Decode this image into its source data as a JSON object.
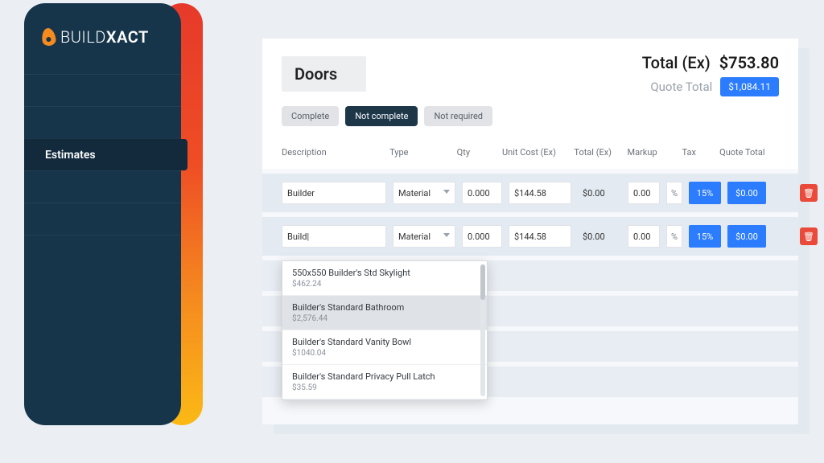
{
  "brand": {
    "part1": "BUILD",
    "part2": "XACT"
  },
  "nav": {
    "active": "Estimates"
  },
  "category": {
    "name": "Doors"
  },
  "totals": {
    "ex_label": "Total (Ex)",
    "ex_value": "$753.80",
    "quote_label": "Quote Total",
    "quote_value": "$1,084.11"
  },
  "status": {
    "complete": "Complete",
    "not_complete": "Not complete",
    "not_required": "Not required"
  },
  "columns": {
    "description": "Description",
    "type": "Type",
    "qty": "Qty",
    "unit_cost": "Unit Cost (Ex)",
    "total_ex": "Total (Ex)",
    "markup": "Markup",
    "tax": "Tax",
    "quote_total": "Quote Total"
  },
  "rows": [
    {
      "desc": "Builder",
      "type": "Material",
      "qty": "0.000",
      "unit_cost": "$144.58",
      "total_ex": "$0.00",
      "markup": "0.00",
      "pct": "%",
      "tax": "15%",
      "quote_total": "$0.00"
    },
    {
      "desc": "Build|",
      "type": "Material",
      "qty": "0.000",
      "unit_cost": "$144.58",
      "total_ex": "$0.00",
      "markup": "0.00",
      "pct": "%",
      "tax": "15%",
      "quote_total": "$0.00"
    }
  ],
  "dropdown": {
    "items": [
      {
        "title": "550x550 Builder's Std Skylight",
        "price": "$462.24"
      },
      {
        "title": "Builder's Standard Bathroom",
        "price": "$2,576.44"
      },
      {
        "title": "Builder's Standard Vanity Bowl",
        "price": "$1040.04"
      },
      {
        "title": "Builder's Standard Privacy Pull Latch",
        "price": "$35.59"
      }
    ],
    "selected_index": 1
  },
  "icons": {
    "delete": "🗑"
  }
}
